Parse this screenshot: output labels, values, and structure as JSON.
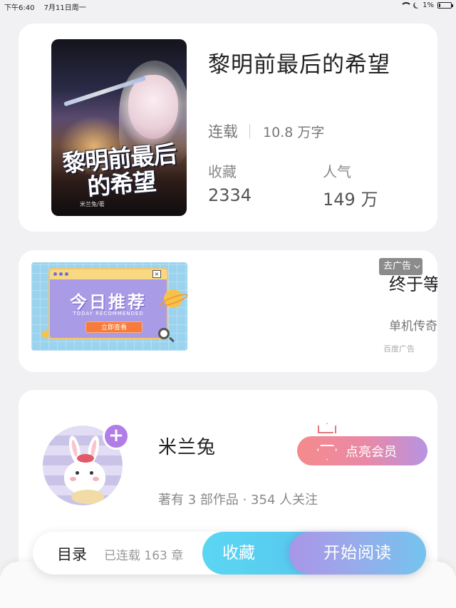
{
  "status_bar": {
    "time": "下午6:40",
    "date": "7月11日周一",
    "battery": "1%"
  },
  "book": {
    "title": "黎明前最后的希望",
    "cover_title": "黎明前最后的希望",
    "cover_author": "米兰兔/著",
    "status": "连载",
    "word_count": "10.8 万字",
    "stats": [
      {
        "label": "收藏",
        "value": "2334"
      },
      {
        "label": "人气",
        "value": "149 万"
      }
    ]
  },
  "ad": {
    "image_headline": "今日推荐",
    "image_subheadline": "TODAY RECOMMENDED",
    "image_cta": "立即查看",
    "title": "终于等到",
    "description": "单机传奇手游",
    "source": "百度广告",
    "remove_label": "去广告"
  },
  "author": {
    "name": "米兰兔",
    "info": "著有 3 部作品 · 354 人关注",
    "vip_label": "点亮会员",
    "follow_symbol": "+"
  },
  "bottom_bar": {
    "toc_label": "目录",
    "chapters_label": "已连载 163 章",
    "collect_label": "收藏",
    "read_label": "开始阅读"
  },
  "colors": {
    "accent_blue": "#56c7ee",
    "accent_purple": "#a996e8",
    "vip_pink": "#f58a8c"
  }
}
